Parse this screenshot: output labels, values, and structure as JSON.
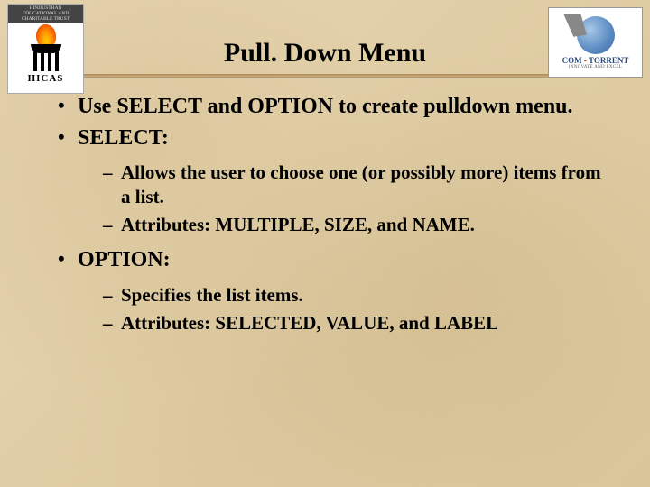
{
  "logos": {
    "left": {
      "banner_top": "HINDUSTHAN",
      "banner_sub": "EDUCATIONAL AND CHARITABLE TRUST",
      "label": "HICAS"
    },
    "right": {
      "brand_a": "COM",
      "brand_dash": " - ",
      "brand_b": "TORRENT",
      "tagline": "INNOVATE AND EXCEL"
    }
  },
  "title": "Pull. Down Menu",
  "bullets": [
    {
      "text": "Use SELECT and OPTION to create pulldown menu."
    },
    {
      "text": "SELECT:",
      "sub": [
        "Allows the user to choose one (or possibly more) items from a list.",
        "Attributes:  MULTIPLE, SIZE, and NAME."
      ]
    },
    {
      "text": "OPTION:",
      "sub": [
        "Specifies the list items.",
        "Attributes:  SELECTED, VALUE, and LABEL"
      ]
    }
  ]
}
